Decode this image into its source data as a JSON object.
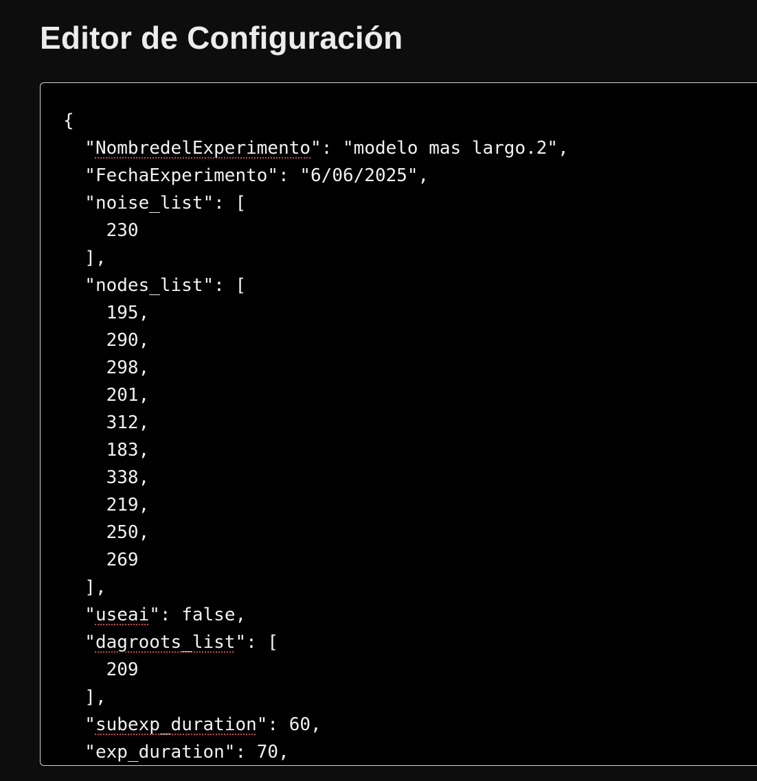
{
  "page": {
    "title": "Editor de Configuración"
  },
  "editor": {
    "lines": [
      {
        "pre": "{",
        "word": "",
        "post": "",
        "flag": false
      },
      {
        "pre": "  \"",
        "word": "NombredelExperimento",
        "post": "\": \"modelo mas largo.2\",",
        "flag": true
      },
      {
        "pre": "  \"FechaExperimento\": \"6/06/2025\",",
        "word": "",
        "post": "",
        "flag": false
      },
      {
        "pre": "  \"noise_list\": [",
        "word": "",
        "post": "",
        "flag": false
      },
      {
        "pre": "    230",
        "word": "",
        "post": "",
        "flag": false
      },
      {
        "pre": "  ],",
        "word": "",
        "post": "",
        "flag": false
      },
      {
        "pre": "  \"nodes_list\": [",
        "word": "",
        "post": "",
        "flag": false
      },
      {
        "pre": "    195,",
        "word": "",
        "post": "",
        "flag": false
      },
      {
        "pre": "    290,",
        "word": "",
        "post": "",
        "flag": false
      },
      {
        "pre": "    298,",
        "word": "",
        "post": "",
        "flag": false
      },
      {
        "pre": "    201,",
        "word": "",
        "post": "",
        "flag": false
      },
      {
        "pre": "    312,",
        "word": "",
        "post": "",
        "flag": false
      },
      {
        "pre": "    183,",
        "word": "",
        "post": "",
        "flag": false
      },
      {
        "pre": "    338,",
        "word": "",
        "post": "",
        "flag": false
      },
      {
        "pre": "    219,",
        "word": "",
        "post": "",
        "flag": false
      },
      {
        "pre": "    250,",
        "word": "",
        "post": "",
        "flag": false
      },
      {
        "pre": "    269",
        "word": "",
        "post": "",
        "flag": false
      },
      {
        "pre": "  ],",
        "word": "",
        "post": "",
        "flag": false
      },
      {
        "pre": "  \"",
        "word": "useai",
        "post": "\": false,",
        "flag": true
      },
      {
        "pre": "  \"",
        "word": "dagroots_list",
        "post": "\": [",
        "flag": true
      },
      {
        "pre": "    209",
        "word": "",
        "post": "",
        "flag": false
      },
      {
        "pre": "  ],",
        "word": "",
        "post": "",
        "flag": false
      },
      {
        "pre": "  \"",
        "word": "subexp_duration",
        "post": "\": 60,",
        "flag": true
      },
      {
        "pre": "  \"exp_duration\": 70,",
        "word": "",
        "post": "",
        "flag": false
      }
    ]
  }
}
